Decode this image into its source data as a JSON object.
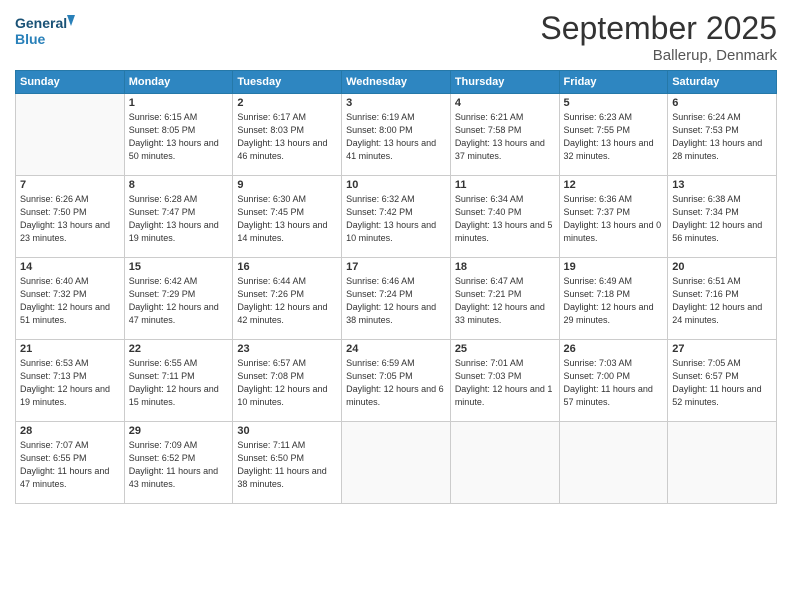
{
  "header": {
    "logo_line1": "General",
    "logo_line2": "Blue",
    "title": "September 2025",
    "subtitle": "Ballerup, Denmark"
  },
  "weekdays": [
    "Sunday",
    "Monday",
    "Tuesday",
    "Wednesday",
    "Thursday",
    "Friday",
    "Saturday"
  ],
  "weeks": [
    [
      {
        "day": "",
        "sunrise": "",
        "sunset": "",
        "daylight": ""
      },
      {
        "day": "1",
        "sunrise": "Sunrise: 6:15 AM",
        "sunset": "Sunset: 8:05 PM",
        "daylight": "Daylight: 13 hours and 50 minutes."
      },
      {
        "day": "2",
        "sunrise": "Sunrise: 6:17 AM",
        "sunset": "Sunset: 8:03 PM",
        "daylight": "Daylight: 13 hours and 46 minutes."
      },
      {
        "day": "3",
        "sunrise": "Sunrise: 6:19 AM",
        "sunset": "Sunset: 8:00 PM",
        "daylight": "Daylight: 13 hours and 41 minutes."
      },
      {
        "day": "4",
        "sunrise": "Sunrise: 6:21 AM",
        "sunset": "Sunset: 7:58 PM",
        "daylight": "Daylight: 13 hours and 37 minutes."
      },
      {
        "day": "5",
        "sunrise": "Sunrise: 6:23 AM",
        "sunset": "Sunset: 7:55 PM",
        "daylight": "Daylight: 13 hours and 32 minutes."
      },
      {
        "day": "6",
        "sunrise": "Sunrise: 6:24 AM",
        "sunset": "Sunset: 7:53 PM",
        "daylight": "Daylight: 13 hours and 28 minutes."
      }
    ],
    [
      {
        "day": "7",
        "sunrise": "Sunrise: 6:26 AM",
        "sunset": "Sunset: 7:50 PM",
        "daylight": "Daylight: 13 hours and 23 minutes."
      },
      {
        "day": "8",
        "sunrise": "Sunrise: 6:28 AM",
        "sunset": "Sunset: 7:47 PM",
        "daylight": "Daylight: 13 hours and 19 minutes."
      },
      {
        "day": "9",
        "sunrise": "Sunrise: 6:30 AM",
        "sunset": "Sunset: 7:45 PM",
        "daylight": "Daylight: 13 hours and 14 minutes."
      },
      {
        "day": "10",
        "sunrise": "Sunrise: 6:32 AM",
        "sunset": "Sunset: 7:42 PM",
        "daylight": "Daylight: 13 hours and 10 minutes."
      },
      {
        "day": "11",
        "sunrise": "Sunrise: 6:34 AM",
        "sunset": "Sunset: 7:40 PM",
        "daylight": "Daylight: 13 hours and 5 minutes."
      },
      {
        "day": "12",
        "sunrise": "Sunrise: 6:36 AM",
        "sunset": "Sunset: 7:37 PM",
        "daylight": "Daylight: 13 hours and 0 minutes."
      },
      {
        "day": "13",
        "sunrise": "Sunrise: 6:38 AM",
        "sunset": "Sunset: 7:34 PM",
        "daylight": "Daylight: 12 hours and 56 minutes."
      }
    ],
    [
      {
        "day": "14",
        "sunrise": "Sunrise: 6:40 AM",
        "sunset": "Sunset: 7:32 PM",
        "daylight": "Daylight: 12 hours and 51 minutes."
      },
      {
        "day": "15",
        "sunrise": "Sunrise: 6:42 AM",
        "sunset": "Sunset: 7:29 PM",
        "daylight": "Daylight: 12 hours and 47 minutes."
      },
      {
        "day": "16",
        "sunrise": "Sunrise: 6:44 AM",
        "sunset": "Sunset: 7:26 PM",
        "daylight": "Daylight: 12 hours and 42 minutes."
      },
      {
        "day": "17",
        "sunrise": "Sunrise: 6:46 AM",
        "sunset": "Sunset: 7:24 PM",
        "daylight": "Daylight: 12 hours and 38 minutes."
      },
      {
        "day": "18",
        "sunrise": "Sunrise: 6:47 AM",
        "sunset": "Sunset: 7:21 PM",
        "daylight": "Daylight: 12 hours and 33 minutes."
      },
      {
        "day": "19",
        "sunrise": "Sunrise: 6:49 AM",
        "sunset": "Sunset: 7:18 PM",
        "daylight": "Daylight: 12 hours and 29 minutes."
      },
      {
        "day": "20",
        "sunrise": "Sunrise: 6:51 AM",
        "sunset": "Sunset: 7:16 PM",
        "daylight": "Daylight: 12 hours and 24 minutes."
      }
    ],
    [
      {
        "day": "21",
        "sunrise": "Sunrise: 6:53 AM",
        "sunset": "Sunset: 7:13 PM",
        "daylight": "Daylight: 12 hours and 19 minutes."
      },
      {
        "day": "22",
        "sunrise": "Sunrise: 6:55 AM",
        "sunset": "Sunset: 7:11 PM",
        "daylight": "Daylight: 12 hours and 15 minutes."
      },
      {
        "day": "23",
        "sunrise": "Sunrise: 6:57 AM",
        "sunset": "Sunset: 7:08 PM",
        "daylight": "Daylight: 12 hours and 10 minutes."
      },
      {
        "day": "24",
        "sunrise": "Sunrise: 6:59 AM",
        "sunset": "Sunset: 7:05 PM",
        "daylight": "Daylight: 12 hours and 6 minutes."
      },
      {
        "day": "25",
        "sunrise": "Sunrise: 7:01 AM",
        "sunset": "Sunset: 7:03 PM",
        "daylight": "Daylight: 12 hours and 1 minute."
      },
      {
        "day": "26",
        "sunrise": "Sunrise: 7:03 AM",
        "sunset": "Sunset: 7:00 PM",
        "daylight": "Daylight: 11 hours and 57 minutes."
      },
      {
        "day": "27",
        "sunrise": "Sunrise: 7:05 AM",
        "sunset": "Sunset: 6:57 PM",
        "daylight": "Daylight: 11 hours and 52 minutes."
      }
    ],
    [
      {
        "day": "28",
        "sunrise": "Sunrise: 7:07 AM",
        "sunset": "Sunset: 6:55 PM",
        "daylight": "Daylight: 11 hours and 47 minutes."
      },
      {
        "day": "29",
        "sunrise": "Sunrise: 7:09 AM",
        "sunset": "Sunset: 6:52 PM",
        "daylight": "Daylight: 11 hours and 43 minutes."
      },
      {
        "day": "30",
        "sunrise": "Sunrise: 7:11 AM",
        "sunset": "Sunset: 6:50 PM",
        "daylight": "Daylight: 11 hours and 38 minutes."
      },
      {
        "day": "",
        "sunrise": "",
        "sunset": "",
        "daylight": ""
      },
      {
        "day": "",
        "sunrise": "",
        "sunset": "",
        "daylight": ""
      },
      {
        "day": "",
        "sunrise": "",
        "sunset": "",
        "daylight": ""
      },
      {
        "day": "",
        "sunrise": "",
        "sunset": "",
        "daylight": ""
      }
    ]
  ]
}
